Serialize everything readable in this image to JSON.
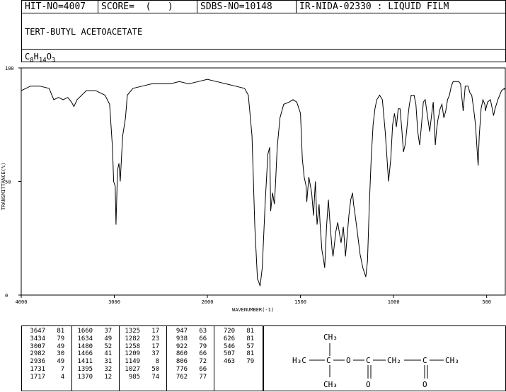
{
  "header": {
    "hit_no": "HIT-NO=4007",
    "score": "SCORE=  (   )",
    "sdbs_no": "SDBS-NO=10148",
    "ir_code": "IR-NIDA-02330 : LIQUID FILM"
  },
  "compound": {
    "name": "TERT-BUTYL ACETOACETATE",
    "formula_c": "C",
    "formula_c_n": "8",
    "formula_h": "H",
    "formula_h_n": "14",
    "formula_o": "O",
    "formula_o_n": "3"
  },
  "chart_data": {
    "type": "line",
    "xlabel": "WAVENUMBER(-1)",
    "ylabel": "TRANSMITTANCE(%)",
    "xlim": [
      4000,
      400
    ],
    "ylim": [
      0,
      100
    ],
    "x_ticks": [
      "4000",
      "3000",
      "2000",
      "1500",
      "1000",
      "500"
    ],
    "y_ticks": [
      "100",
      "50",
      "0"
    ],
    "series": [
      {
        "points": [
          [
            4000,
            90
          ],
          [
            3900,
            92
          ],
          [
            3800,
            92
          ],
          [
            3700,
            91
          ],
          [
            3650,
            86
          ],
          [
            3600,
            87
          ],
          [
            3550,
            86
          ],
          [
            3500,
            87
          ],
          [
            3460,
            85
          ],
          [
            3434,
            83
          ],
          [
            3400,
            86
          ],
          [
            3300,
            90
          ],
          [
            3200,
            90
          ],
          [
            3100,
            88
          ],
          [
            3050,
            84
          ],
          [
            3020,
            65
          ],
          [
            3007,
            50
          ],
          [
            2990,
            48
          ],
          [
            2982,
            31
          ],
          [
            2965,
            55
          ],
          [
            2950,
            58
          ],
          [
            2936,
            50
          ],
          [
            2910,
            70
          ],
          [
            2880,
            78
          ],
          [
            2860,
            88
          ],
          [
            2800,
            91
          ],
          [
            2700,
            92
          ],
          [
            2600,
            93
          ],
          [
            2500,
            93
          ],
          [
            2400,
            93
          ],
          [
            2300,
            94
          ],
          [
            2200,
            93
          ],
          [
            2100,
            94
          ],
          [
            2000,
            95
          ],
          [
            1950,
            94
          ],
          [
            1900,
            93
          ],
          [
            1850,
            92
          ],
          [
            1800,
            91
          ],
          [
            1780,
            88
          ],
          [
            1760,
            70
          ],
          [
            1745,
            30
          ],
          [
            1731,
            7
          ],
          [
            1725,
            6
          ],
          [
            1717,
            4
          ],
          [
            1705,
            12
          ],
          [
            1690,
            40
          ],
          [
            1675,
            62
          ],
          [
            1665,
            65
          ],
          [
            1660,
            37
          ],
          [
            1650,
            45
          ],
          [
            1640,
            40
          ],
          [
            1634,
            49
          ],
          [
            1625,
            65
          ],
          [
            1610,
            78
          ],
          [
            1590,
            84
          ],
          [
            1560,
            85
          ],
          [
            1540,
            86
          ],
          [
            1520,
            85
          ],
          [
            1500,
            80
          ],
          [
            1490,
            60
          ],
          [
            1480,
            52
          ],
          [
            1470,
            48
          ],
          [
            1466,
            41
          ],
          [
            1455,
            52
          ],
          [
            1440,
            45
          ],
          [
            1430,
            35
          ],
          [
            1420,
            50
          ],
          [
            1411,
            31
          ],
          [
            1400,
            40
          ],
          [
            1395,
            32
          ],
          [
            1385,
            20
          ],
          [
            1375,
            15
          ],
          [
            1370,
            12
          ],
          [
            1360,
            30
          ],
          [
            1350,
            42
          ],
          [
            1340,
            30
          ],
          [
            1330,
            20
          ],
          [
            1325,
            17
          ],
          [
            1310,
            28
          ],
          [
            1300,
            32
          ],
          [
            1290,
            27
          ],
          [
            1282,
            23
          ],
          [
            1270,
            30
          ],
          [
            1265,
            25
          ],
          [
            1258,
            17
          ],
          [
            1250,
            25
          ],
          [
            1240,
            35
          ],
          [
            1230,
            42
          ],
          [
            1220,
            45
          ],
          [
            1215,
            40
          ],
          [
            1209,
            37
          ],
          [
            1195,
            28
          ],
          [
            1180,
            18
          ],
          [
            1165,
            12
          ],
          [
            1149,
            8
          ],
          [
            1140,
            15
          ],
          [
            1130,
            40
          ],
          [
            1120,
            60
          ],
          [
            1110,
            75
          ],
          [
            1100,
            82
          ],
          [
            1090,
            86
          ],
          [
            1075,
            88
          ],
          [
            1060,
            86
          ],
          [
            1045,
            72
          ],
          [
            1035,
            60
          ],
          [
            1027,
            50
          ],
          [
            1015,
            60
          ],
          [
            1005,
            75
          ],
          [
            995,
            80
          ],
          [
            985,
            74
          ],
          [
            975,
            82
          ],
          [
            965,
            82
          ],
          [
            955,
            72
          ],
          [
            947,
            63
          ],
          [
            938,
            66
          ],
          [
            930,
            72
          ],
          [
            922,
            79
          ],
          [
            915,
            84
          ],
          [
            905,
            88
          ],
          [
            890,
            88
          ],
          [
            880,
            84
          ],
          [
            870,
            72
          ],
          [
            860,
            66
          ],
          [
            850,
            75
          ],
          [
            840,
            85
          ],
          [
            830,
            86
          ],
          [
            820,
            80
          ],
          [
            806,
            72
          ],
          [
            795,
            80
          ],
          [
            787,
            85
          ],
          [
            776,
            66
          ],
          [
            770,
            72
          ],
          [
            762,
            77
          ],
          [
            750,
            82
          ],
          [
            740,
            84
          ],
          [
            730,
            78
          ],
          [
            720,
            81
          ],
          [
            710,
            86
          ],
          [
            700,
            88
          ],
          [
            690,
            92
          ],
          [
            680,
            94
          ],
          [
            670,
            94
          ],
          [
            660,
            94
          ],
          [
            650,
            94
          ],
          [
            640,
            93
          ],
          [
            626,
            81
          ],
          [
            615,
            92
          ],
          [
            600,
            92
          ],
          [
            590,
            89
          ],
          [
            580,
            88
          ],
          [
            570,
            82
          ],
          [
            560,
            75
          ],
          [
            546,
            57
          ],
          [
            540,
            70
          ],
          [
            530,
            82
          ],
          [
            520,
            86
          ],
          [
            510,
            84
          ],
          [
            507,
            81
          ],
          [
            495,
            85
          ],
          [
            480,
            86
          ],
          [
            470,
            82
          ],
          [
            463,
            79
          ],
          [
            455,
            82
          ],
          [
            440,
            86
          ],
          [
            420,
            90
          ],
          [
            405,
            91
          ],
          [
            400,
            90
          ]
        ]
      }
    ]
  },
  "peaks": [
    [
      [
        "3647",
        "81"
      ],
      [
        "3434",
        "79"
      ],
      [
        "3007",
        "49"
      ],
      [
        "2982",
        "30"
      ],
      [
        "2936",
        "49"
      ],
      [
        "1731",
        "7"
      ],
      [
        "1717",
        "4"
      ]
    ],
    [
      [
        "1660",
        "37"
      ],
      [
        "1634",
        "49"
      ],
      [
        "1480",
        "52"
      ],
      [
        "1466",
        "41"
      ],
      [
        "1411",
        "31"
      ],
      [
        "1395",
        "32"
      ],
      [
        "1370",
        "12"
      ]
    ],
    [
      [
        "1325",
        "17"
      ],
      [
        "1282",
        "23"
      ],
      [
        "1258",
        "17"
      ],
      [
        "1209",
        "37"
      ],
      [
        "1149",
        "8"
      ],
      [
        "1027",
        "50"
      ],
      [
        "985",
        "74"
      ]
    ],
    [
      [
        "947",
        "63"
      ],
      [
        "938",
        "66"
      ],
      [
        "922",
        "79"
      ],
      [
        "860",
        "66"
      ],
      [
        "806",
        "72"
      ],
      [
        "776",
        "66"
      ],
      [
        "762",
        "77"
      ]
    ],
    [
      [
        "720",
        "81"
      ],
      [
        "626",
        "81"
      ],
      [
        "546",
        "57"
      ],
      [
        "507",
        "81"
      ],
      [
        "463",
        "79"
      ]
    ]
  ],
  "structure": {
    "h3c": "H₃C",
    "ch3_top": "CH₃",
    "ch3_bottom": "CH₃",
    "c_center": "C",
    "o": "O",
    "c1": "C",
    "ch2": "CH₂",
    "c2": "C",
    "ch3_right": "CH₃",
    "o_dbl1": "O",
    "o_dbl2": "O"
  }
}
